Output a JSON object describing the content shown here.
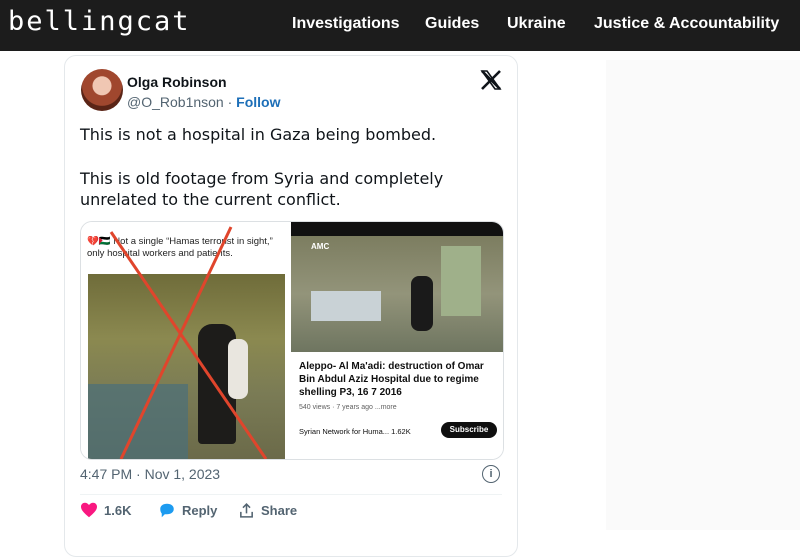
{
  "site": {
    "logo": "bellingcat",
    "menu": [
      "Investigations",
      "Guides",
      "Ukraine",
      "Justice & Accountability"
    ]
  },
  "tweet": {
    "author": "Olga Robinson",
    "handle": "@O_Rob1nson",
    "separator": "·",
    "follow": "Follow",
    "text_line1": "This is not a hospital in Gaza being bombed.",
    "text_line2": "This is old footage from Syria and completely",
    "text_line3": "unrelated to the current conflict.",
    "date": "4:47 PM · Nov 1, 2023",
    "likes": "1.6K",
    "reply_label": "Reply",
    "share_label": "Share",
    "info_icon": "i"
  },
  "media": {
    "left_caption": "💔🇵🇸 Not a single “Hamas terrorist in sight,” only hospital workers and patients.",
    "yt_title": "Aleppo- Al Ma'adi: destruction of Omar Bin Abdul Aziz Hospital due to regime shelling P3, 16 7 2016",
    "yt_meta": "540 views · 7 years ago  ...more",
    "yt_channel": "Syrian Network for Huma...  1.62K",
    "yt_subscribe": "Subscribe",
    "yt_overlay": "AMC"
  },
  "colors": {
    "nav_bg": "#1c1c1c",
    "like_red": "#f91880",
    "follow_blue": "#1d6fb8",
    "cross_red": "#e0452c"
  }
}
